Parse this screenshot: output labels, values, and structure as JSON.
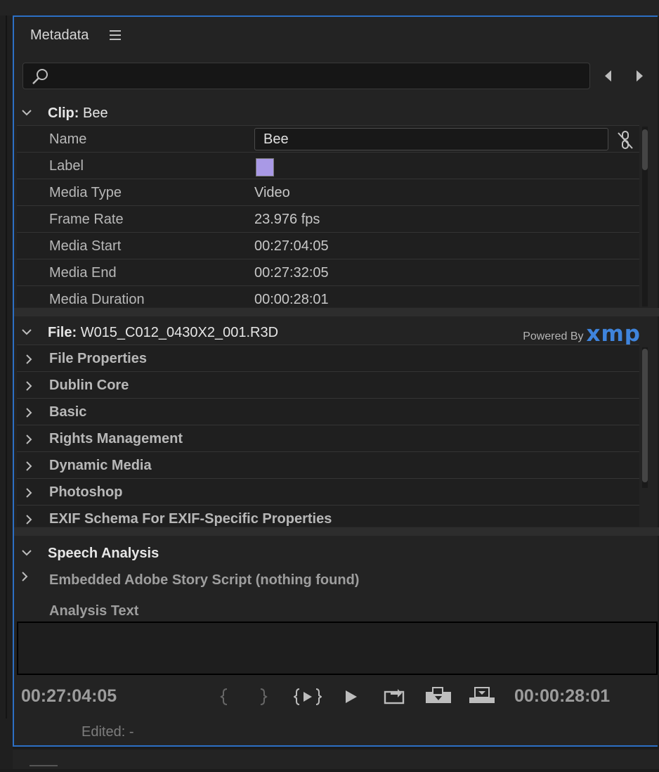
{
  "panel": {
    "title": "Metadata",
    "search": {
      "value": "",
      "placeholder": ""
    }
  },
  "clip": {
    "heading": "Clip:",
    "name": "Bee",
    "rows": [
      {
        "key": "Name",
        "value": "Bee"
      },
      {
        "key": "Label",
        "value": "",
        "color": "#a999e6"
      },
      {
        "key": "Media Type",
        "value": "Video"
      },
      {
        "key": "Frame Rate",
        "value": "23.976 fps"
      },
      {
        "key": "Media Start",
        "value": "00:27:04:05"
      },
      {
        "key": "Media End",
        "value": "00:27:32:05"
      },
      {
        "key": "Media Duration",
        "value": "00:00:28:01"
      }
    ]
  },
  "file": {
    "heading": "File:",
    "name": "W015_C012_0430X2_001.R3D",
    "powered_by": "Powered By",
    "xmp": "xmp",
    "groups": [
      "File Properties",
      "Dublin Core",
      "Basic",
      "Rights Management",
      "Dynamic Media",
      "Photoshop",
      "EXIF Schema For EXIF-Specific Properties"
    ]
  },
  "speech": {
    "heading": "Speech Analysis",
    "embedded": "Embedded Adobe Story Script (nothing found)",
    "analysis_label": "Analysis Text",
    "analysis_value": ""
  },
  "footer": {
    "in_timecode": "00:27:04:05",
    "duration_timecode": "00:00:28:01",
    "edited": "Edited: -"
  },
  "colors": {
    "accent": "#2c6fc4",
    "xmp": "#3f84dc",
    "label": "#a999e6"
  }
}
